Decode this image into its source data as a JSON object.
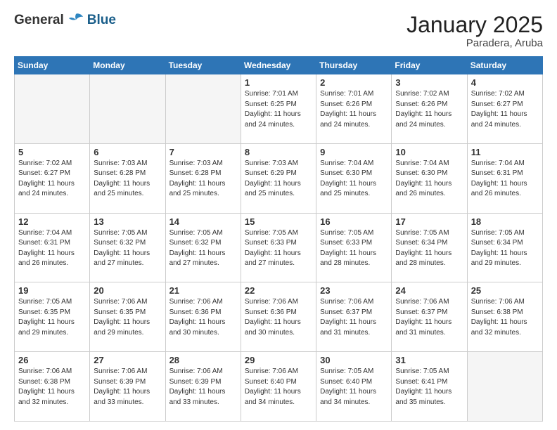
{
  "header": {
    "logo_general": "General",
    "logo_blue": "Blue",
    "title": "January 2025",
    "subtitle": "Paradera, Aruba"
  },
  "weekdays": [
    "Sunday",
    "Monday",
    "Tuesday",
    "Wednesday",
    "Thursday",
    "Friday",
    "Saturday"
  ],
  "weeks": [
    [
      {
        "day": "",
        "empty": true
      },
      {
        "day": "",
        "empty": true
      },
      {
        "day": "",
        "empty": true
      },
      {
        "day": "1",
        "sunrise": "7:01 AM",
        "sunset": "6:25 PM",
        "daylight": "11 hours and 24 minutes."
      },
      {
        "day": "2",
        "sunrise": "7:01 AM",
        "sunset": "6:26 PM",
        "daylight": "11 hours and 24 minutes."
      },
      {
        "day": "3",
        "sunrise": "7:02 AM",
        "sunset": "6:26 PM",
        "daylight": "11 hours and 24 minutes."
      },
      {
        "day": "4",
        "sunrise": "7:02 AM",
        "sunset": "6:27 PM",
        "daylight": "11 hours and 24 minutes."
      }
    ],
    [
      {
        "day": "5",
        "sunrise": "7:02 AM",
        "sunset": "6:27 PM",
        "daylight": "11 hours and 24 minutes."
      },
      {
        "day": "6",
        "sunrise": "7:03 AM",
        "sunset": "6:28 PM",
        "daylight": "11 hours and 25 minutes."
      },
      {
        "day": "7",
        "sunrise": "7:03 AM",
        "sunset": "6:28 PM",
        "daylight": "11 hours and 25 minutes."
      },
      {
        "day": "8",
        "sunrise": "7:03 AM",
        "sunset": "6:29 PM",
        "daylight": "11 hours and 25 minutes."
      },
      {
        "day": "9",
        "sunrise": "7:04 AM",
        "sunset": "6:30 PM",
        "daylight": "11 hours and 25 minutes."
      },
      {
        "day": "10",
        "sunrise": "7:04 AM",
        "sunset": "6:30 PM",
        "daylight": "11 hours and 26 minutes."
      },
      {
        "day": "11",
        "sunrise": "7:04 AM",
        "sunset": "6:31 PM",
        "daylight": "11 hours and 26 minutes."
      }
    ],
    [
      {
        "day": "12",
        "sunrise": "7:04 AM",
        "sunset": "6:31 PM",
        "daylight": "11 hours and 26 minutes."
      },
      {
        "day": "13",
        "sunrise": "7:05 AM",
        "sunset": "6:32 PM",
        "daylight": "11 hours and 27 minutes."
      },
      {
        "day": "14",
        "sunrise": "7:05 AM",
        "sunset": "6:32 PM",
        "daylight": "11 hours and 27 minutes."
      },
      {
        "day": "15",
        "sunrise": "7:05 AM",
        "sunset": "6:33 PM",
        "daylight": "11 hours and 27 minutes."
      },
      {
        "day": "16",
        "sunrise": "7:05 AM",
        "sunset": "6:33 PM",
        "daylight": "11 hours and 28 minutes."
      },
      {
        "day": "17",
        "sunrise": "7:05 AM",
        "sunset": "6:34 PM",
        "daylight": "11 hours and 28 minutes."
      },
      {
        "day": "18",
        "sunrise": "7:05 AM",
        "sunset": "6:34 PM",
        "daylight": "11 hours and 29 minutes."
      }
    ],
    [
      {
        "day": "19",
        "sunrise": "7:05 AM",
        "sunset": "6:35 PM",
        "daylight": "11 hours and 29 minutes."
      },
      {
        "day": "20",
        "sunrise": "7:06 AM",
        "sunset": "6:35 PM",
        "daylight": "11 hours and 29 minutes."
      },
      {
        "day": "21",
        "sunrise": "7:06 AM",
        "sunset": "6:36 PM",
        "daylight": "11 hours and 30 minutes."
      },
      {
        "day": "22",
        "sunrise": "7:06 AM",
        "sunset": "6:36 PM",
        "daylight": "11 hours and 30 minutes."
      },
      {
        "day": "23",
        "sunrise": "7:06 AM",
        "sunset": "6:37 PM",
        "daylight": "11 hours and 31 minutes."
      },
      {
        "day": "24",
        "sunrise": "7:06 AM",
        "sunset": "6:37 PM",
        "daylight": "11 hours and 31 minutes."
      },
      {
        "day": "25",
        "sunrise": "7:06 AM",
        "sunset": "6:38 PM",
        "daylight": "11 hours and 32 minutes."
      }
    ],
    [
      {
        "day": "26",
        "sunrise": "7:06 AM",
        "sunset": "6:38 PM",
        "daylight": "11 hours and 32 minutes."
      },
      {
        "day": "27",
        "sunrise": "7:06 AM",
        "sunset": "6:39 PM",
        "daylight": "11 hours and 33 minutes."
      },
      {
        "day": "28",
        "sunrise": "7:06 AM",
        "sunset": "6:39 PM",
        "daylight": "11 hours and 33 minutes."
      },
      {
        "day": "29",
        "sunrise": "7:06 AM",
        "sunset": "6:40 PM",
        "daylight": "11 hours and 34 minutes."
      },
      {
        "day": "30",
        "sunrise": "7:05 AM",
        "sunset": "6:40 PM",
        "daylight": "11 hours and 34 minutes."
      },
      {
        "day": "31",
        "sunrise": "7:05 AM",
        "sunset": "6:41 PM",
        "daylight": "11 hours and 35 minutes."
      },
      {
        "day": "",
        "empty": true
      }
    ]
  ],
  "labels": {
    "sunrise": "Sunrise:",
    "sunset": "Sunset:",
    "daylight": "Daylight:"
  }
}
